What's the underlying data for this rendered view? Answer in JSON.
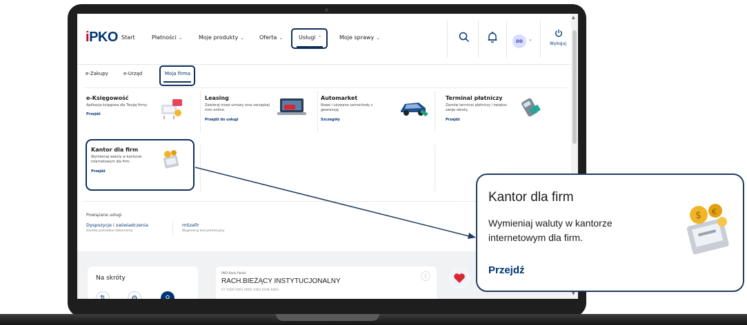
{
  "logo": {
    "prefix": "i",
    "text": "PKO"
  },
  "nav": {
    "items": [
      {
        "label": "Start",
        "chevron": ""
      },
      {
        "label": "Płatności",
        "chevron": "⌄"
      },
      {
        "label": "Moje produkty",
        "chevron": "⌄"
      },
      {
        "label": "Oferta",
        "chevron": "⌄"
      },
      {
        "label": "Usługi",
        "chevron": "⌃"
      },
      {
        "label": "Moje sprawy",
        "chevron": "⌄"
      }
    ],
    "active_index": 4
  },
  "header_icons": {
    "search": "search-icon",
    "bell": "bell-icon"
  },
  "user": {
    "initials": "DD",
    "chevron": "⌄",
    "logout_label": "Wyloguj"
  },
  "subtabs": {
    "items": [
      "e-Zakupy",
      "e-Urząd",
      "Moja firma"
    ],
    "active_index": 2
  },
  "services": [
    {
      "title": "e-Księgowość",
      "desc": "Aplikacja księgowa dla Twojej firmy.",
      "link": "Przejdź"
    },
    {
      "title": "Leasing",
      "desc": "Zawieraj nowe umowy oraz zarządzaj nimi online.",
      "link": "Przejdź do usługi"
    },
    {
      "title": "Automarket",
      "desc": "Nowe i używane samochody z gwarancją",
      "link": "Szczegóły"
    },
    {
      "title": "Terminal płatniczy",
      "desc": "Zamów terminal płatniczy i zwiększ swoje obroty.",
      "link": "Przejdź"
    },
    {
      "title": "Kantor dla firm",
      "desc": "Wymieniaj waluty w kantorze internetowym dla firm.",
      "link": "Przejdź"
    }
  ],
  "related": {
    "label": "Powiązane usługi",
    "items": [
      {
        "title": "Dyspozycje i zaświadczenia",
        "desc": "Zamów potrzebne dokumenty"
      },
      {
        "title": "mSzafir",
        "desc": "Wygeneruj kod promocyjny"
      }
    ]
  },
  "shortcuts": {
    "title": "Na skróty"
  },
  "account": {
    "bank": "PKO Bank Polski",
    "name": "RACH.BIEŻĄCY INSTYTUCJONALNY",
    "number": "57 1020 5561 0000 3302 0346 6463",
    "menu": "⋮"
  },
  "callout": {
    "title": "Kantor dla firm",
    "desc": "Wymieniaj waluty w kantorze internetowym dla firm.",
    "link": "Przejdź"
  },
  "colors": {
    "brand_navy": "#003574",
    "brand_red": "#d1001f",
    "highlight": "#0e2e5a"
  }
}
